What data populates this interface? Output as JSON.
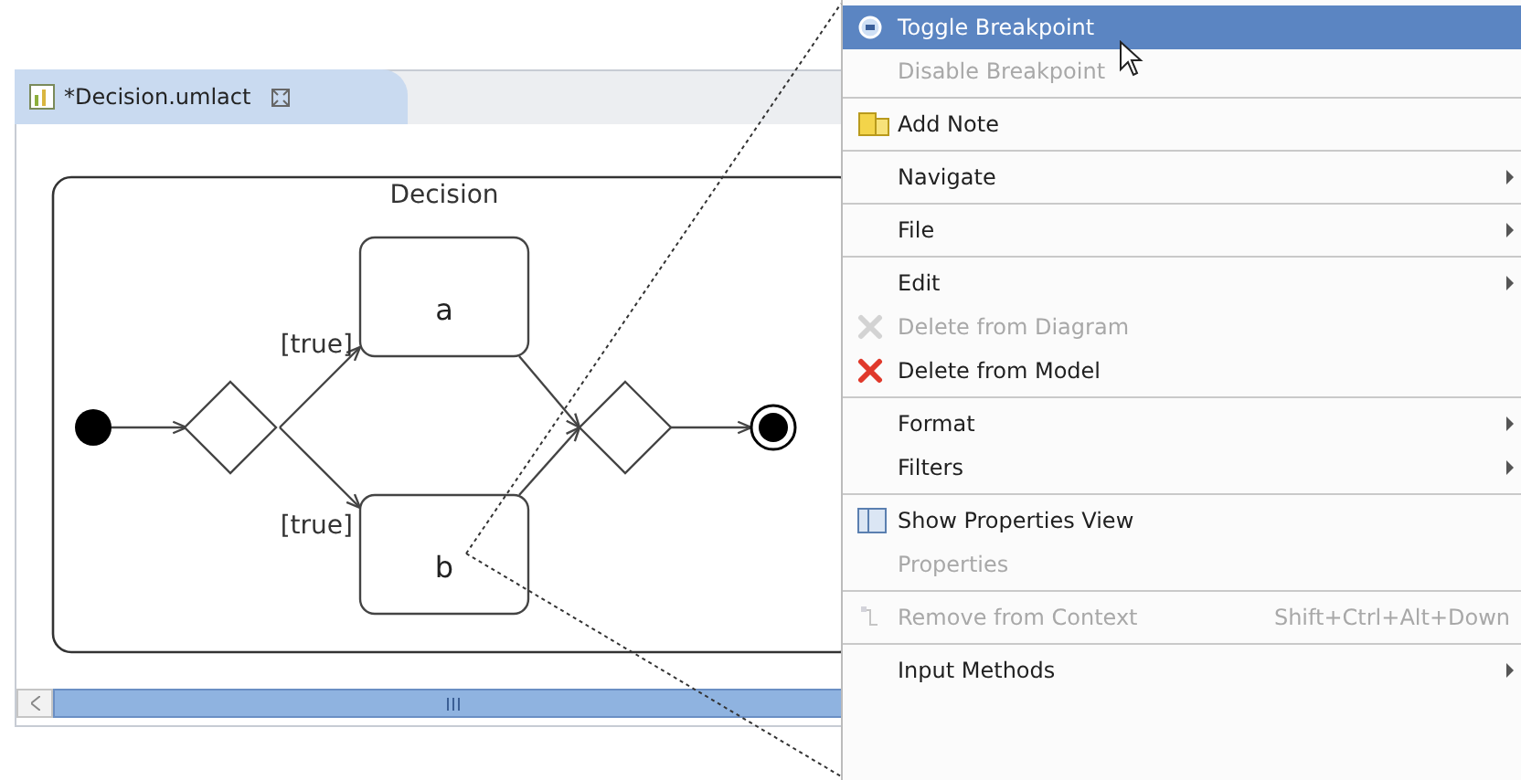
{
  "editor": {
    "tab": {
      "title": "*Decision.umlact",
      "selected": true
    },
    "diagram": {
      "title": "Decision",
      "actions": [
        {
          "label": "a"
        },
        {
          "label": "b"
        }
      ],
      "guards": [
        "[true]",
        "[true]"
      ]
    }
  },
  "context_menu": {
    "groups": [
      [
        {
          "label": "Toggle Breakpoint",
          "selected": true,
          "disabled": false,
          "submenu": false
        },
        {
          "label": "Disable Breakpoint",
          "selected": false,
          "disabled": true,
          "submenu": false
        }
      ],
      [
        {
          "label": "Add Note",
          "selected": false,
          "disabled": false,
          "submenu": false
        }
      ],
      [
        {
          "label": "Navigate",
          "selected": false,
          "disabled": false,
          "submenu": true
        }
      ],
      [
        {
          "label": "File",
          "selected": false,
          "disabled": false,
          "submenu": true
        }
      ],
      [
        {
          "label": "Edit",
          "selected": false,
          "disabled": false,
          "submenu": true
        },
        {
          "label": "Delete from Diagram",
          "selected": false,
          "disabled": true,
          "submenu": false
        },
        {
          "label": "Delete from Model",
          "selected": false,
          "disabled": false,
          "submenu": false
        }
      ],
      [
        {
          "label": "Format",
          "selected": false,
          "disabled": false,
          "submenu": true
        },
        {
          "label": "Filters",
          "selected": false,
          "disabled": false,
          "submenu": true
        }
      ],
      [
        {
          "label": "Show Properties View",
          "selected": false,
          "disabled": false,
          "submenu": false
        },
        {
          "label": "Properties",
          "selected": false,
          "disabled": true,
          "submenu": false
        }
      ],
      [
        {
          "label": "Remove from Context",
          "shortcut": "Shift+Ctrl+Alt+Down",
          "selected": false,
          "disabled": true,
          "submenu": false
        }
      ],
      [
        {
          "label": "Input Methods",
          "selected": false,
          "disabled": false,
          "submenu": true
        }
      ]
    ]
  }
}
